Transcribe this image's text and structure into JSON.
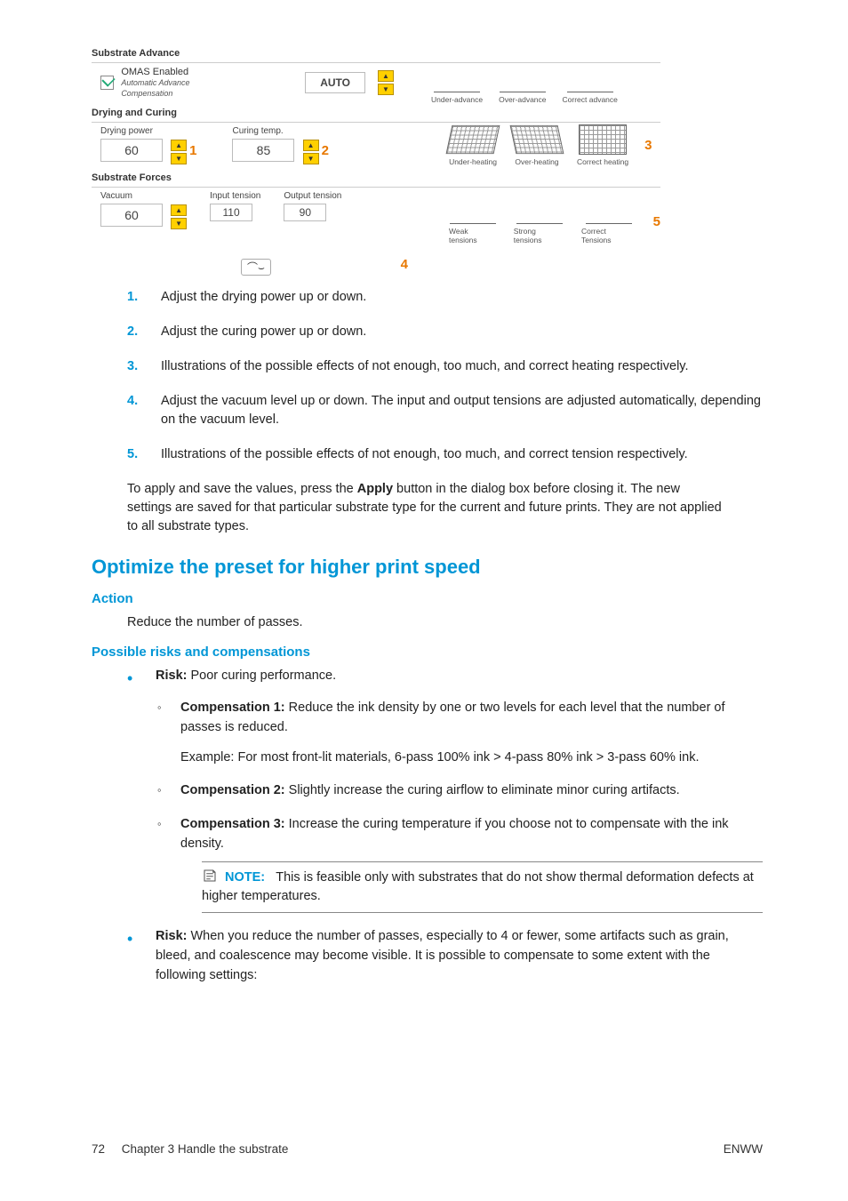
{
  "shot": {
    "section_advance": "Substrate Advance",
    "omas_label": "OMAS Enabled",
    "omas_sub": "Automatic Advance Compensation",
    "auto_btn": "AUTO",
    "section_drying": "Drying and Curing",
    "drying_power_label": "Drying power",
    "drying_power_value": "60",
    "curing_temp_label": "Curing temp.",
    "curing_temp_value": "85",
    "section_forces": "Substrate Forces",
    "vacuum_label": "Vacuum",
    "vacuum_value": "60",
    "input_tension_label": "Input tension",
    "input_tension_value": "110",
    "output_tension_label": "Output tension",
    "output_tension_value": "90",
    "illus_adv": {
      "a": "Under-advance",
      "b": "Over-advance",
      "c": "Correct advance"
    },
    "illus_heat": {
      "a": "Under-heating",
      "b": "Over-heating",
      "c": "Correct heating"
    },
    "illus_ten": {
      "a": "Weak tensions",
      "b": "Strong tensions",
      "c": "Correct Tensions"
    },
    "call1": "1",
    "call2": "2",
    "call3": "3",
    "call4": "4",
    "call5": "5"
  },
  "numlist": {
    "i1": "Adjust the drying power up or down.",
    "i2": "Adjust the curing power up or down.",
    "i3": "Illustrations of the possible effects of not enough, too much, and correct heating respectively.",
    "i4": "Adjust the vacuum level up or down. The input and output tensions are adjusted automatically, depending on the vacuum level.",
    "i5": "Illustrations of the possible effects of not enough, too much, and correct tension respectively."
  },
  "apply_para": {
    "p1": "To apply and save the values, press the ",
    "bold": "Apply",
    "p2": " button in the dialog box before closing it. The new settings are saved for that particular substrate type for the current and future prints. They are not applied to all substrate types."
  },
  "h2": "Optimize the preset for higher print speed",
  "h3_action": "Action",
  "action_p": "Reduce the number of passes.",
  "h3_risks": "Possible risks and compensations",
  "risk1": {
    "lead": "Risk:",
    "text": " Poor curing performance."
  },
  "comp1": {
    "lead": "Compensation 1:",
    "text": " Reduce the ink density by one or two levels for each level that the number of passes is reduced.",
    "example": "Example: For most front-lit materials, 6-pass 100% ink > 4-pass 80% ink > 3-pass 60% ink."
  },
  "comp2": {
    "lead": "Compensation 2:",
    "text": " Slightly increase the curing airflow to eliminate minor curing artifacts."
  },
  "comp3": {
    "lead": "Compensation 3:",
    "text": " Increase the curing temperature if you choose not to compensate with the ink density."
  },
  "note": {
    "lead": "NOTE:",
    "text": "This is feasible only with substrates that do not show thermal deformation defects at higher temperatures."
  },
  "risk2": {
    "lead": "Risk:",
    "text": " When you reduce the number of passes, especially to 4 or fewer, some artifacts such as grain, bleed, and coalescence may become visible. It is possible to compensate to some extent with the following settings:"
  },
  "footer": {
    "left_page": "72",
    "left_text": "Chapter 3   Handle the substrate",
    "right": "ENWW"
  }
}
